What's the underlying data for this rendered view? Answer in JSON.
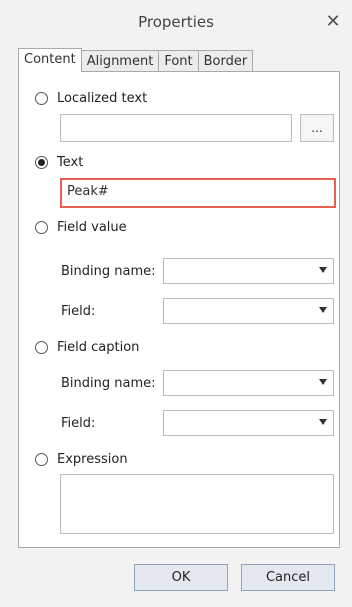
{
  "dialog": {
    "title": "Properties",
    "close_glyph": "✕"
  },
  "tabs": [
    {
      "label": "Content",
      "active": true
    },
    {
      "label": "Alignment",
      "active": false
    },
    {
      "label": "Font",
      "active": false
    },
    {
      "label": "Border",
      "active": false
    }
  ],
  "content": {
    "localized_text": {
      "label": "Localized text",
      "value": "",
      "button_label": "..."
    },
    "text": {
      "label": "Text",
      "value": "Peak#",
      "selected": true
    },
    "field_value": {
      "label": "Field value",
      "binding_name_label": "Binding name:",
      "binding_name_value": "",
      "field_label": "Field:",
      "field_value": ""
    },
    "field_caption": {
      "label": "Field caption",
      "binding_name_label": "Binding name:",
      "binding_name_value": "",
      "field_label": "Field:",
      "field_value": ""
    },
    "expression": {
      "label": "Expression",
      "value": ""
    }
  },
  "buttons": {
    "ok": "OK",
    "cancel": "Cancel"
  },
  "colors": {
    "focus_border": "#e8604f",
    "button_border": "#8fa3bd",
    "button_bg": "#e4e9f0"
  }
}
